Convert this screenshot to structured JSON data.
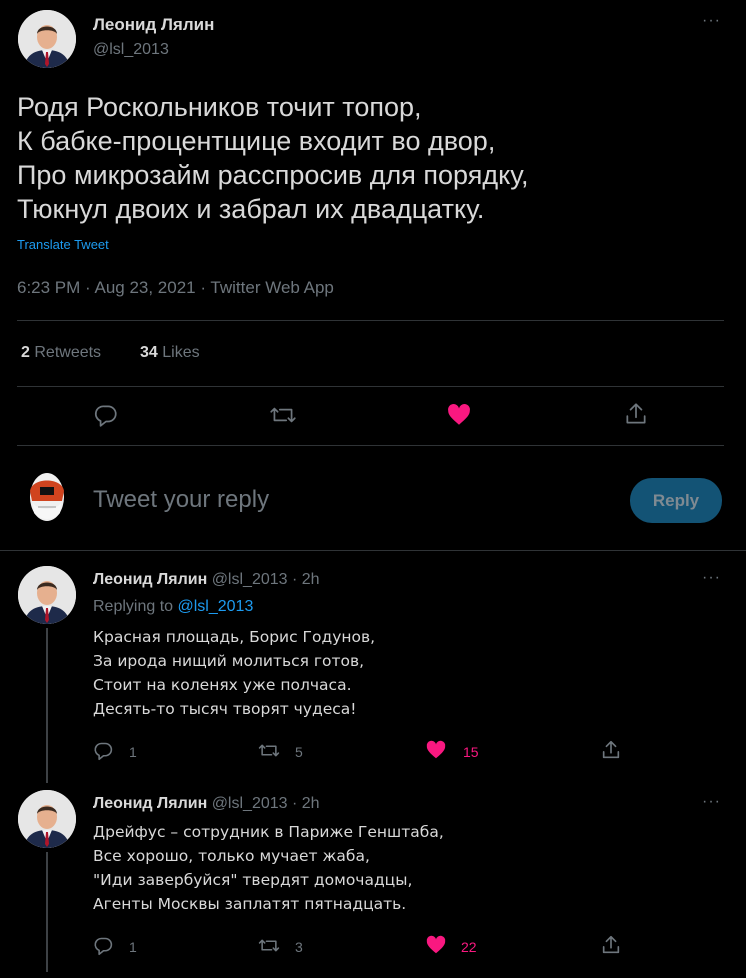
{
  "main_tweet": {
    "author": "Леонид Лялин",
    "handle": "@lsl_2013",
    "lines": [
      "Родя Роскольников точит топор,",
      "К бабке-процентщице входит во двор,",
      "Про микрозайм расспросив для порядку,",
      "Тюкнул двоих и забрал их двадцатку."
    ],
    "translate": "Translate Tweet",
    "meta": "6:23 PM · Aug 23, 2021 · Twitter Web App",
    "retweets_count": "2",
    "retweets_label": "Retweets",
    "likes_count": "34",
    "likes_label": "Likes"
  },
  "compose": {
    "placeholder": "Tweet your reply",
    "button": "Reply"
  },
  "replies": [
    {
      "author": "Леонид Лялин",
      "handle": "@lsl_2013",
      "time": "2h",
      "replying_prefix": "Replying to",
      "replying_handle": "@lsl_2013",
      "lines": [
        "Красная площадь, Борис Годунов,",
        "За ирода нищий молиться готов,",
        "Стоит на коленях уже полчаса.",
        "Десять-то тысяч творят чудеса!"
      ],
      "reply_count": "1",
      "retweet_count": "5",
      "like_count": "15"
    },
    {
      "author": "Леонид Лялин",
      "handle": "@lsl_2013",
      "time": "2h",
      "lines": [
        "Дрейфус – сотрудник в Париже Генштаба,",
        "Все хорошо, только мучает жаба,",
        "\"Иди завербуйся\" твердят домочадцы,",
        "Агенты Москвы заплатят пятнадцать."
      ],
      "reply_count": "1",
      "retweet_count": "3",
      "like_count": "22"
    }
  ],
  "colors": {
    "background": "#000000",
    "text": "#d9d9d9",
    "muted": "#6e767d",
    "link": "#1d9bf0",
    "like": "#f91880",
    "reply_button": "#135375"
  },
  "icons": [
    "more-icon",
    "reply-icon",
    "retweet-icon",
    "heart-icon",
    "share-icon"
  ]
}
